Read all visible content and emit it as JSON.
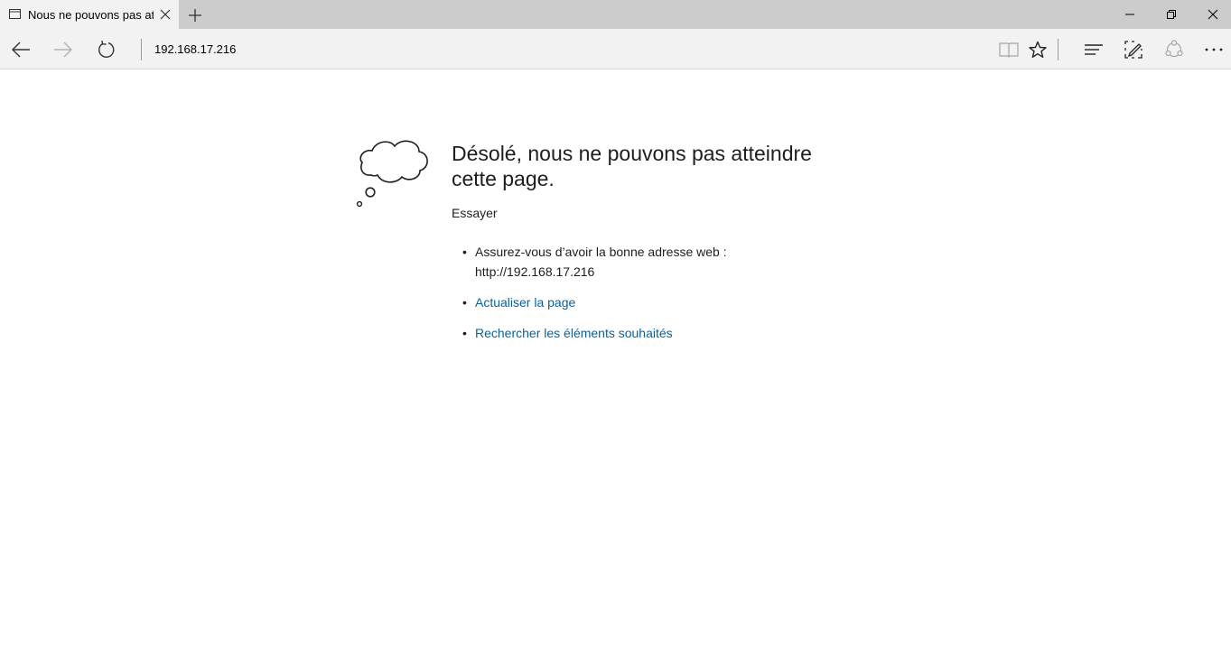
{
  "tab": {
    "title": "Nous ne pouvons pas at",
    "icon": "page-icon"
  },
  "toolbar": {
    "address": "192.168.17.216",
    "icons": [
      "back-arrow-icon",
      "forward-arrow-icon",
      "refresh-icon",
      "reading-view-icon",
      "favorite-star-icon",
      "hub-icon",
      "web-note-icon",
      "share-icon",
      "more-icon"
    ]
  },
  "error": {
    "title": "Désolé, nous ne pouvons pas atteindre cette page.",
    "try_label": "Essayer",
    "suggestion_address_text": "Assurez-vous d’avoir la bonne adresse web :",
    "suggestion_address_url": "http://192.168.17.216",
    "refresh_link": "Actualiser la page",
    "search_link": "Rechercher les éléments souhaités"
  },
  "colors": {
    "link": "#0063b1",
    "tabstrip": "#cccccc",
    "toolbar": "#f2f2f2",
    "text": "#1e1e1e"
  }
}
